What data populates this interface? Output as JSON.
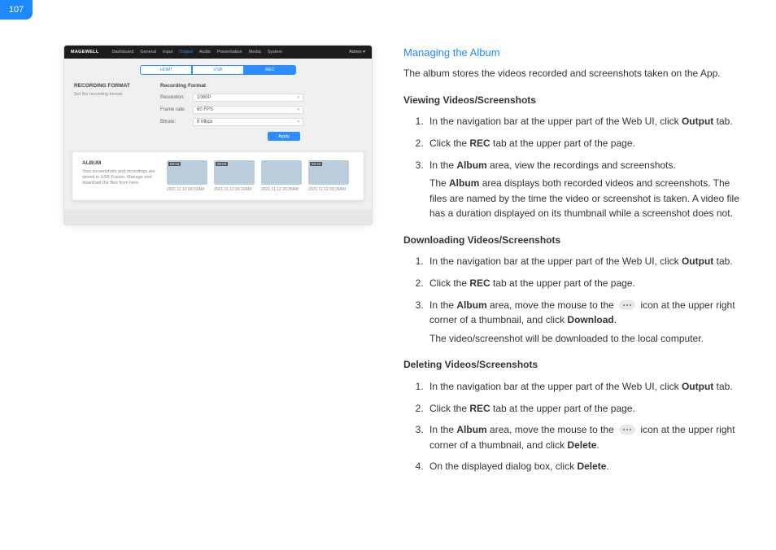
{
  "page_number": "107",
  "shot": {
    "brand": "MAGEWELL",
    "nav": [
      "Dashboard",
      "General",
      "Input",
      "Output",
      "Audio",
      "Presentation",
      "Media",
      "System"
    ],
    "nav_active_index": 3,
    "admin": "Admin ▾",
    "tabs": [
      "HDMI",
      "USB",
      "REC"
    ],
    "tab_selected_index": 2,
    "rec_format": {
      "side_title": "RECORDING FORMAT",
      "side_desc": "Set the recording format.",
      "title": "Recording Format",
      "fields": [
        {
          "label": "Resolution:",
          "value": "1080P"
        },
        {
          "label": "Frame rate:",
          "value": "60 FPS"
        },
        {
          "label": "Bitrate:",
          "value": "8 Mbps"
        }
      ],
      "apply": "Apply"
    },
    "album": {
      "title": "ALBUM",
      "desc": "Your screenshots and recordings are stored in USB Fusion. Manage and download the files from here.",
      "thumbs": [
        {
          "caption": "2021.11.12 09:33AM",
          "duration": "00:03"
        },
        {
          "caption": "2021.11.12 09:32AM",
          "duration": "00:03"
        },
        {
          "caption": "2021.11.12 09:35AM",
          "duration": ""
        },
        {
          "caption": "2021.11.12 09:26AM",
          "duration": "00:43"
        }
      ]
    }
  },
  "doc": {
    "h1": "Managing the Album",
    "intro": "The album stores the videos recorded and screenshots taken on the App.",
    "sections": [
      {
        "title": "Viewing Videos/Screenshots",
        "steps": [
          {
            "pre": "In the navigation bar at the upper part of the Web UI, click ",
            "bold": "Output",
            "post": " tab."
          },
          {
            "pre": "Click the ",
            "bold": "REC",
            "post": " tab at the upper part of the page."
          },
          {
            "pre": "In the ",
            "bold": "Album",
            "post": " area, view the recordings and screenshots.",
            "sub_pre": "The ",
            "sub_bold": "Album",
            "sub_post": " area displays both recorded videos and screenshots. The files are named by the time the video or screenshot is taken. A video file has a duration displayed on its thumbnail while a screenshot does not."
          }
        ]
      },
      {
        "title": "Downloading Videos/Screenshots",
        "steps": [
          {
            "pre": "In the navigation bar at the upper part of the Web UI, click ",
            "bold": "Output",
            "post": " tab."
          },
          {
            "pre": "Click the ",
            "bold": "REC",
            "post": " tab at the upper part of the page."
          },
          {
            "pre": "In the ",
            "bold": "Album",
            "post": " area, move the mouse to the ",
            "icon": "dots",
            "post2": " icon at the upper right corner of a thumbnail, and click ",
            "bold2": "Download",
            "post3": ".",
            "sub_post": "The video/screenshot will be downloaded to the local computer."
          }
        ]
      },
      {
        "title": "Deleting Videos/Screenshots",
        "steps": [
          {
            "pre": "In the navigation bar at the upper part of the Web UI, click ",
            "bold": "Output",
            "post": " tab."
          },
          {
            "pre": "Click the ",
            "bold": "REC",
            "post": " tab at the upper part of the page."
          },
          {
            "pre": "In the ",
            "bold": "Album",
            "post": " area, move the mouse to the ",
            "icon": "dots",
            "post2": " icon at the upper right corner of a thumbnail, and click ",
            "bold2": "Delete",
            "post3": "."
          },
          {
            "pre": "On the displayed dialog box, click ",
            "bold": "Delete",
            "post": "."
          }
        ]
      }
    ]
  }
}
